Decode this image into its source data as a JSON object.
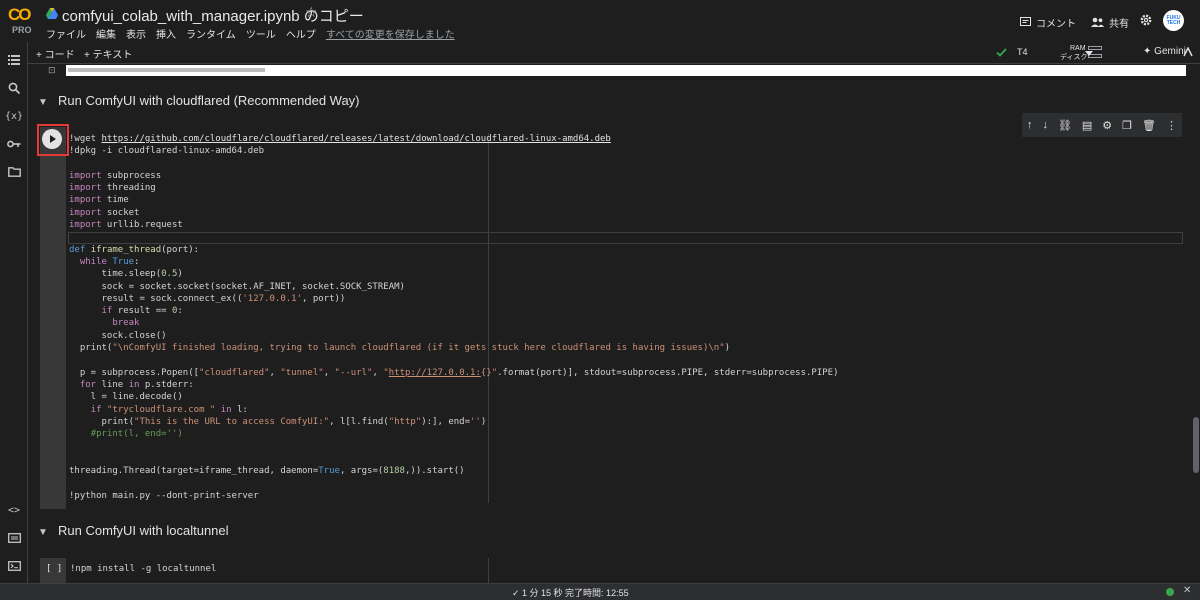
{
  "header": {
    "logo_text": "CO",
    "logo_sub": "PRO",
    "title": "comfyui_colab_with_manager.ipynb のコピー",
    "star": "☆",
    "menu": [
      "ファイル",
      "編集",
      "表示",
      "挿入",
      "ランタイム",
      "ツール",
      "ヘルプ"
    ],
    "saved_text": "すべての変更を保存しました",
    "comment_label": "コメント",
    "share_label": "共有",
    "avatar_text": "FUKU TECH"
  },
  "toolbar": {
    "add_code": "+ コード",
    "add_text": "+ テキスト",
    "runtime": "T4",
    "ram_label": "RAM",
    "disk_label": "ディスク",
    "gemini": "Gemini"
  },
  "sections": {
    "cloudflared_title": "Run ComfyUI with cloudflared (Recommended Way)",
    "localtunnel_title": "Run ComfyUI with localtunnel"
  },
  "cell2": {
    "prompt": "[ ]",
    "code": "!npm install -g localtunnel"
  },
  "status": {
    "text": "✓  1 分 15 秒    完了時間: 12:55"
  },
  "colors": {
    "background": "#1e1e1e",
    "run_highlight": "#e53935",
    "connected": "#34a853"
  }
}
